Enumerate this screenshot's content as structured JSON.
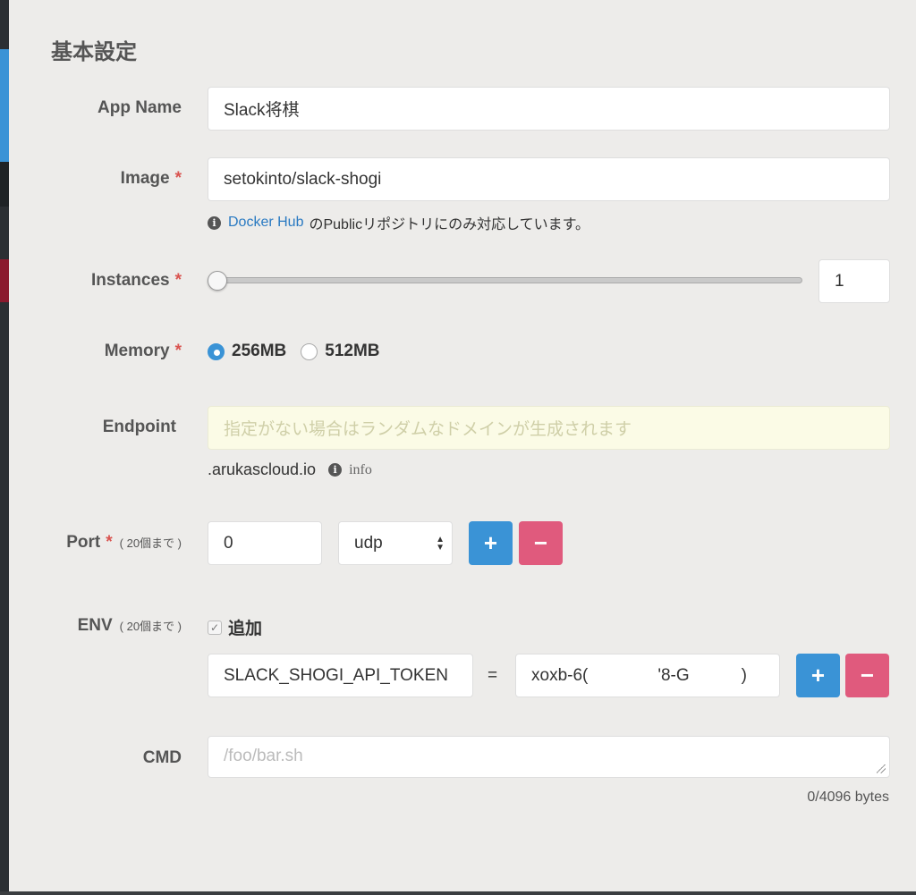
{
  "section": {
    "title": "基本設定"
  },
  "app_name": {
    "label": "App Name",
    "value": "Slack将棋"
  },
  "image": {
    "label": "Image",
    "required": "*",
    "value": "setokinto/slack-shogi",
    "help_link": "Docker Hub",
    "help_text": "のPublicリポジトリにのみ対応しています。"
  },
  "instances": {
    "label": "Instances",
    "required": "*",
    "value": "1",
    "slider_fraction": 0
  },
  "memory": {
    "label": "Memory",
    "required": "*",
    "options": [
      {
        "label": "256MB",
        "selected": true
      },
      {
        "label": "512MB",
        "selected": false
      }
    ]
  },
  "endpoint": {
    "label": "Endpoint",
    "placeholder": "指定がない場合はランダムなドメインが生成されます",
    "suffix": ".arukascloud.io",
    "info_label": "info"
  },
  "port": {
    "label": "Port",
    "required": "*",
    "limit": "( 20個まで )",
    "value": "0",
    "protocol": "udp",
    "add_label": "+",
    "remove_label": "−"
  },
  "env": {
    "label": "ENV",
    "limit": "( 20個まで )",
    "add_checkbox_label": "追加",
    "check_mark": "✓",
    "key": "SLACK_SHOGI_API_TOKEN",
    "equals": "=",
    "value_segments": [
      "xoxb-6(",
      "'8-G",
      ")"
    ],
    "add_label": "+",
    "remove_label": "−"
  },
  "cmd": {
    "label": "CMD",
    "placeholder": "/foo/bar.sh",
    "counter": "0/4096 bytes"
  },
  "colors": {
    "accent": "#3a93d6",
    "danger": "#e05a7d",
    "required": "#d9534f"
  }
}
